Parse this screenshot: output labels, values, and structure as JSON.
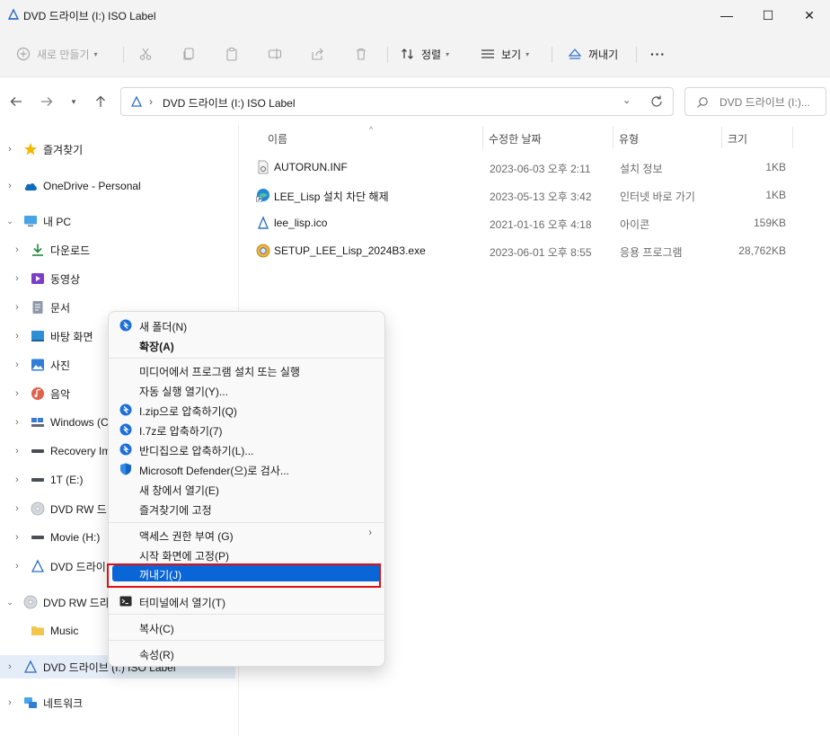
{
  "window": {
    "title": "DVD 드라이브 (I:) ISO Label",
    "minimize": "—",
    "maximize": "☐",
    "close": "✕"
  },
  "toolbar": {
    "new": "새로 만들기",
    "sort": "정렬",
    "view": "보기",
    "eject": "꺼내기",
    "more": "···"
  },
  "address": {
    "path": "DVD 드라이브 (I:) ISO Label",
    "search_placeholder": "DVD 드라이브 (I:)..."
  },
  "nav": {
    "items": [
      {
        "label": "즐겨찾기",
        "icon": "star-icon"
      },
      {
        "label": "OneDrive - Personal",
        "icon": "cloud-icon"
      },
      {
        "label": "내 PC",
        "icon": "pc-icon"
      },
      {
        "label": "다운로드",
        "icon": "download-icon"
      },
      {
        "label": "동영상",
        "icon": "video-icon"
      },
      {
        "label": "문서",
        "icon": "document-icon"
      },
      {
        "label": "바탕 화면",
        "icon": "desktop-icon"
      },
      {
        "label": "사진",
        "icon": "picture-icon"
      },
      {
        "label": "음악",
        "icon": "music-icon"
      },
      {
        "label": "Windows (C",
        "icon": "windows-drive-icon"
      },
      {
        "label": "Recovery Im",
        "icon": "drive-icon"
      },
      {
        "label": "1T (E:)",
        "icon": "drive-icon"
      },
      {
        "label": "DVD RW 드",
        "icon": "disc-icon"
      },
      {
        "label": "Movie (H:)",
        "icon": "drive-icon"
      },
      {
        "label": "DVD 드라이",
        "icon": "dvd-icon"
      },
      {
        "label": "DVD RW 드라",
        "icon": "disc-icon"
      },
      {
        "label": "Music",
        "icon": "folder-icon"
      },
      {
        "label": "DVD 드라이브 (I:) ISO Label",
        "icon": "dvd-icon"
      },
      {
        "label": "네트워크",
        "icon": "network-icon"
      }
    ]
  },
  "columns": {
    "name": "이름",
    "date": "수정한 날짜",
    "type": "유형",
    "size": "크기"
  },
  "files": [
    {
      "name": "AUTORUN.INF",
      "date": "2023-06-03 오후 2:11",
      "type": "설치 정보",
      "size": "1KB"
    },
    {
      "name": "LEE_Lisp 설치 차단 해제",
      "date": "2023-05-13 오후 3:42",
      "type": "인터넷 바로 가기",
      "size": "1KB"
    },
    {
      "name": "lee_lisp.ico",
      "date": "2021-01-16 오후 4:18",
      "type": "아이콘",
      "size": "159KB"
    },
    {
      "name": "SETUP_LEE_Lisp_2024B3.exe",
      "date": "2023-06-01 오후 8:55",
      "type": "응용 프로그램",
      "size": "28,762KB"
    }
  ],
  "context_menu": {
    "items": [
      {
        "label": "새 폴더(N)"
      },
      {
        "label": "확장(A)"
      },
      {
        "label": "미디어에서 프로그램 설치 또는 실행"
      },
      {
        "label": "자동 실행 열기(Y)..."
      },
      {
        "label": "I.zip으로 압축하기(Q)"
      },
      {
        "label": "I.7z로 압축하기(7)"
      },
      {
        "label": "반디집으로 압축하기(L)..."
      },
      {
        "label": "Microsoft Defender(으)로 검사..."
      },
      {
        "label": "새 창에서 열기(E)"
      },
      {
        "label": "즐겨찾기에 고정"
      },
      {
        "label": "액세스 권한 부여 (G)"
      },
      {
        "label": "시작 화면에 고정(P)"
      },
      {
        "label": "꺼내기(J)"
      },
      {
        "label": "터미널에서 열기(T)"
      },
      {
        "label": "복사(C)"
      },
      {
        "label": "속성(R)"
      }
    ]
  },
  "colors": {
    "accent": "#0a66d6",
    "highlight_box": "#e01010",
    "selection": "#e5eef8"
  }
}
